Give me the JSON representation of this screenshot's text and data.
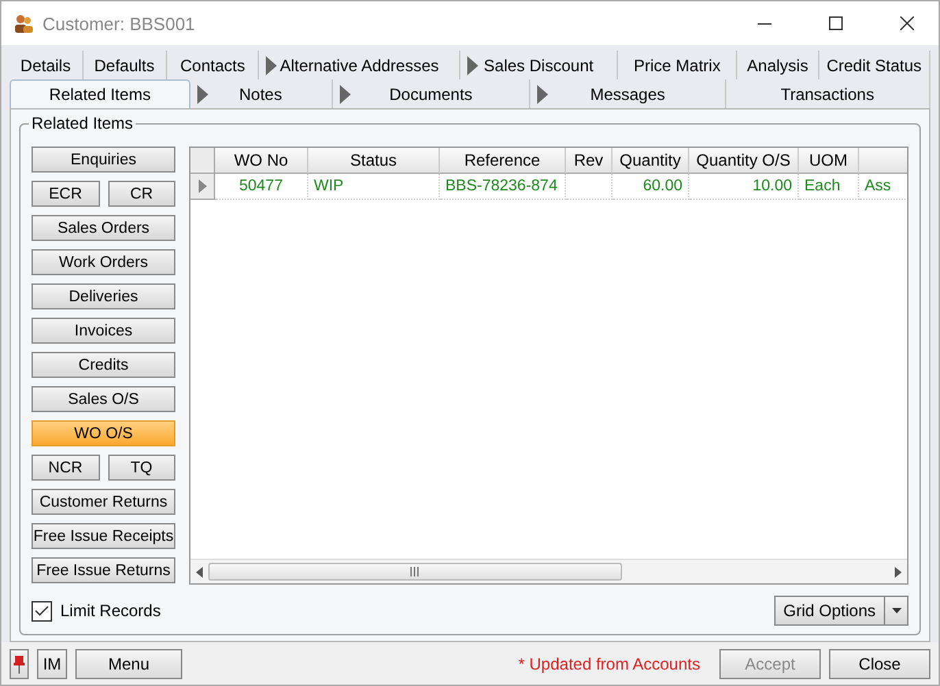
{
  "window": {
    "title": "Customer: BBS001"
  },
  "tab_rows": [
    [
      {
        "label": "Details",
        "selected": false,
        "arrow": false
      },
      {
        "label": "Defaults",
        "selected": false,
        "arrow": false
      },
      {
        "label": "Contacts",
        "selected": false,
        "arrow": false
      },
      {
        "label": "Alternative Addresses",
        "selected": false,
        "arrow": true
      },
      {
        "label": "Sales Discount",
        "selected": false,
        "arrow": true
      },
      {
        "label": "Price Matrix",
        "selected": false,
        "arrow": false
      },
      {
        "label": "Analysis",
        "selected": false,
        "arrow": false
      },
      {
        "label": "Credit Status",
        "selected": false,
        "arrow": false
      }
    ],
    [
      {
        "label": "Related Items",
        "selected": true,
        "arrow": false
      },
      {
        "label": "Notes",
        "selected": false,
        "arrow": true
      },
      {
        "label": "Documents",
        "selected": false,
        "arrow": true
      },
      {
        "label": "Messages",
        "selected": false,
        "arrow": true
      },
      {
        "label": "Transactions",
        "selected": false,
        "arrow": false
      }
    ]
  ],
  "group": {
    "title": "Related Items"
  },
  "side_buttons": [
    {
      "kind": "single",
      "items": [
        {
          "label": "Enquiries",
          "selected": false
        }
      ]
    },
    {
      "kind": "pair",
      "items": [
        {
          "label": "ECR",
          "selected": false
        },
        {
          "label": "CR",
          "selected": false
        }
      ]
    },
    {
      "kind": "single",
      "items": [
        {
          "label": "Sales Orders",
          "selected": false
        }
      ]
    },
    {
      "kind": "single",
      "items": [
        {
          "label": "Work Orders",
          "selected": false
        }
      ]
    },
    {
      "kind": "single",
      "items": [
        {
          "label": "Deliveries",
          "selected": false
        }
      ]
    },
    {
      "kind": "single",
      "items": [
        {
          "label": "Invoices",
          "selected": false
        }
      ]
    },
    {
      "kind": "single",
      "items": [
        {
          "label": "Credits",
          "selected": false
        }
      ]
    },
    {
      "kind": "single",
      "items": [
        {
          "label": "Sales O/S",
          "selected": false
        }
      ]
    },
    {
      "kind": "single",
      "items": [
        {
          "label": "WO O/S",
          "selected": true
        }
      ]
    },
    {
      "kind": "pair",
      "items": [
        {
          "label": "NCR",
          "selected": false
        },
        {
          "label": "TQ",
          "selected": false
        }
      ]
    },
    {
      "kind": "single",
      "items": [
        {
          "label": "Customer Returns",
          "selected": false
        }
      ]
    },
    {
      "kind": "single",
      "items": [
        {
          "label": "Free Issue Receipts",
          "selected": false
        }
      ]
    },
    {
      "kind": "single",
      "items": [
        {
          "label": "Free Issue Returns",
          "selected": false
        }
      ]
    }
  ],
  "limit_records": {
    "label": "Limit Records",
    "checked": true
  },
  "table": {
    "columns": [
      {
        "label": "WO No"
      },
      {
        "label": "Status"
      },
      {
        "label": "Reference"
      },
      {
        "label": "Rev"
      },
      {
        "label": "Quantity"
      },
      {
        "label": "Quantity O/S"
      },
      {
        "label": "UOM"
      }
    ],
    "rows": [
      {
        "cells": [
          "50477",
          "WIP",
          "BBS-78236-874",
          "",
          "60.00",
          "10.00",
          "Each",
          "Ass"
        ]
      }
    ]
  },
  "grid_options": {
    "label": "Grid Options"
  },
  "footer": {
    "pin": true,
    "im": "IM",
    "menu": "Menu",
    "note": "* Updated from Accounts",
    "accept": {
      "label": "Accept",
      "disabled": true
    },
    "close": {
      "label": "Close",
      "disabled": false
    }
  }
}
